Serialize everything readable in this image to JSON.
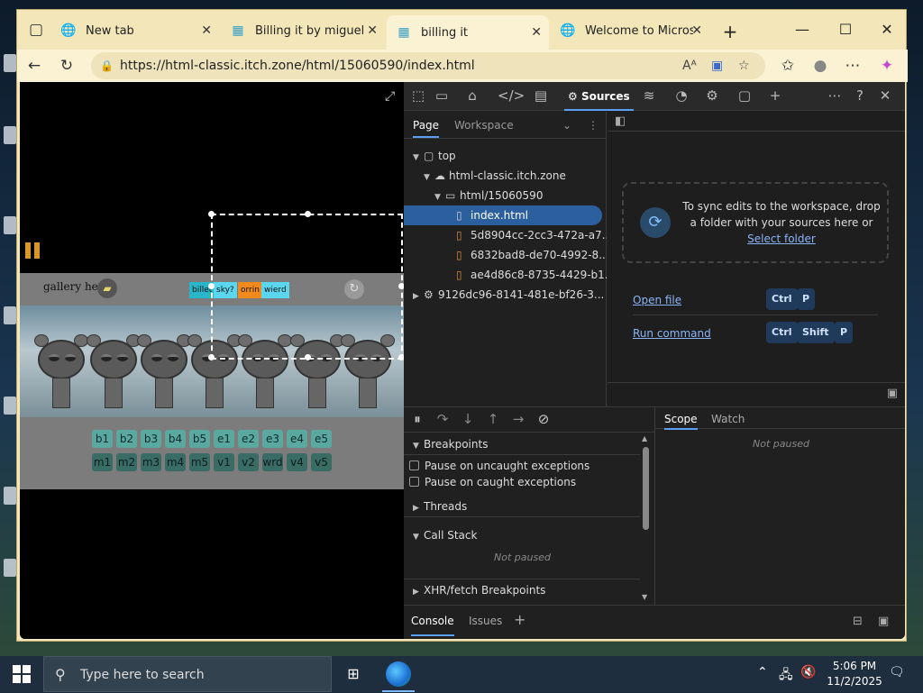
{
  "tabs": [
    {
      "title": "New tab",
      "icon": "globe-icon"
    },
    {
      "title": "Billing it by miguelRoblox",
      "icon": "game-icon"
    },
    {
      "title": "billing it",
      "icon": "game-icon",
      "active": true
    },
    {
      "title": "Welcome to Microsoft",
      "icon": "globe-icon"
    }
  ],
  "window": {
    "new_tab": "+",
    "minimize": "—",
    "maximize": "☐",
    "close": "✕"
  },
  "address": {
    "url": "https://html-classic.itch.zone/html/15060590/index.html"
  },
  "game": {
    "gallery_label": "gallery here",
    "tags": [
      {
        "text": "billet",
        "color": "#29b6c9"
      },
      {
        "text": "sky?",
        "color": "#5ad6ee"
      },
      {
        "text": "orrin",
        "color": "#f08a1c"
      },
      {
        "text": "wierd",
        "color": "#5ad6ee"
      }
    ],
    "row1": [
      "b1",
      "b2",
      "b3",
      "b4",
      "b5",
      "e1",
      "e2",
      "e3",
      "e4",
      "e5"
    ],
    "row2": [
      "m1",
      "m2",
      "m3",
      "m4",
      "m5",
      "v1",
      "v2",
      "wrd",
      "v4",
      "v5"
    ]
  },
  "devtools": {
    "sources_label": "Sources",
    "nav_tabs": [
      "Page",
      "Workspace"
    ],
    "tree": [
      {
        "label": "top",
        "indent": 0,
        "type": "frame",
        "open": true
      },
      {
        "label": "html-classic.itch.zone",
        "indent": 1,
        "type": "cloud",
        "open": true
      },
      {
        "label": "html/15060590",
        "indent": 2,
        "type": "folder",
        "open": true
      },
      {
        "label": "index.html",
        "indent": 3,
        "type": "file",
        "selected": true
      },
      {
        "label": "5d8904cc-2cc3-472a-a7...",
        "indent": 3,
        "type": "doc"
      },
      {
        "label": "6832bad8-de70-4992-8...",
        "indent": 3,
        "type": "doc"
      },
      {
        "label": "ae4d86c8-8735-4429-b1...",
        "indent": 3,
        "type": "doc"
      },
      {
        "label": "9126dc96-8141-481e-bf26-3...",
        "indent": 0,
        "type": "ext",
        "open": false
      }
    ],
    "sync_text": "To sync edits to the workspace, drop a folder with your sources here or",
    "sync_link": "Select folder",
    "open_file": "Open file",
    "open_file_keys": [
      "Ctrl",
      "P"
    ],
    "run_command": "Run command",
    "run_command_keys": [
      "Ctrl",
      "Shift",
      "P"
    ],
    "breakpoints": "Breakpoints",
    "pause_uncaught": "Pause on uncaught exceptions",
    "pause_caught": "Pause on caught exceptions",
    "threads": "Threads",
    "call_stack": "Call Stack",
    "not_paused": "Not paused",
    "xhr": "XHR/fetch Breakpoints",
    "scope_tabs": [
      "Scope",
      "Watch"
    ],
    "scope_not_paused": "Not paused",
    "drawer_tabs": [
      "Console",
      "Issues"
    ]
  },
  "taskbar": {
    "search_placeholder": "Type here to search",
    "time": "5:06 PM",
    "date": "11/2/2025"
  }
}
